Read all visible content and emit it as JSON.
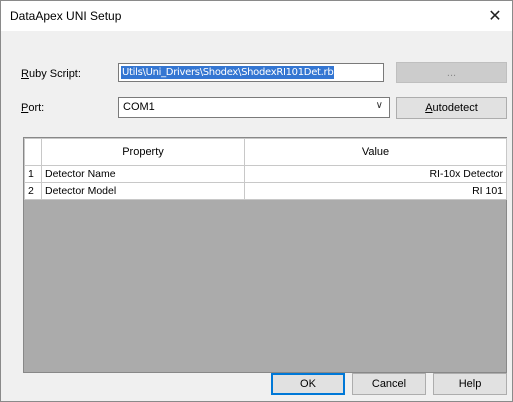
{
  "window": {
    "title": "DataApex UNI Setup",
    "close_glyph": "✕"
  },
  "script": {
    "label_prefix": "R",
    "label_rest": "uby Script:",
    "value": "Utils\\Uni_Drivers\\Shodex\\ShodexRI101Det.rb",
    "browse_label": "..."
  },
  "port": {
    "label_prefix": "P",
    "label_rest": "ort:",
    "value": "COM1",
    "chevron": "∨",
    "autodetect_prefix": "A",
    "autodetect_rest": "utodetect"
  },
  "grid": {
    "headers": [
      "Property",
      "Value"
    ],
    "rows": [
      {
        "index": "1",
        "property": "Detector Name",
        "value": "RI-10x Detector"
      },
      {
        "index": "2",
        "property": "Detector Model",
        "value": "RI 101"
      }
    ]
  },
  "footer": {
    "ok_label": "OK",
    "cancel_label": "Cancel",
    "help_label": "Help"
  },
  "colors": {
    "selection": "#3476d2",
    "default_button_border": "#0078d7"
  },
  "icons": {
    "close": "close-icon",
    "dropdown": "chevron-down-icon"
  }
}
